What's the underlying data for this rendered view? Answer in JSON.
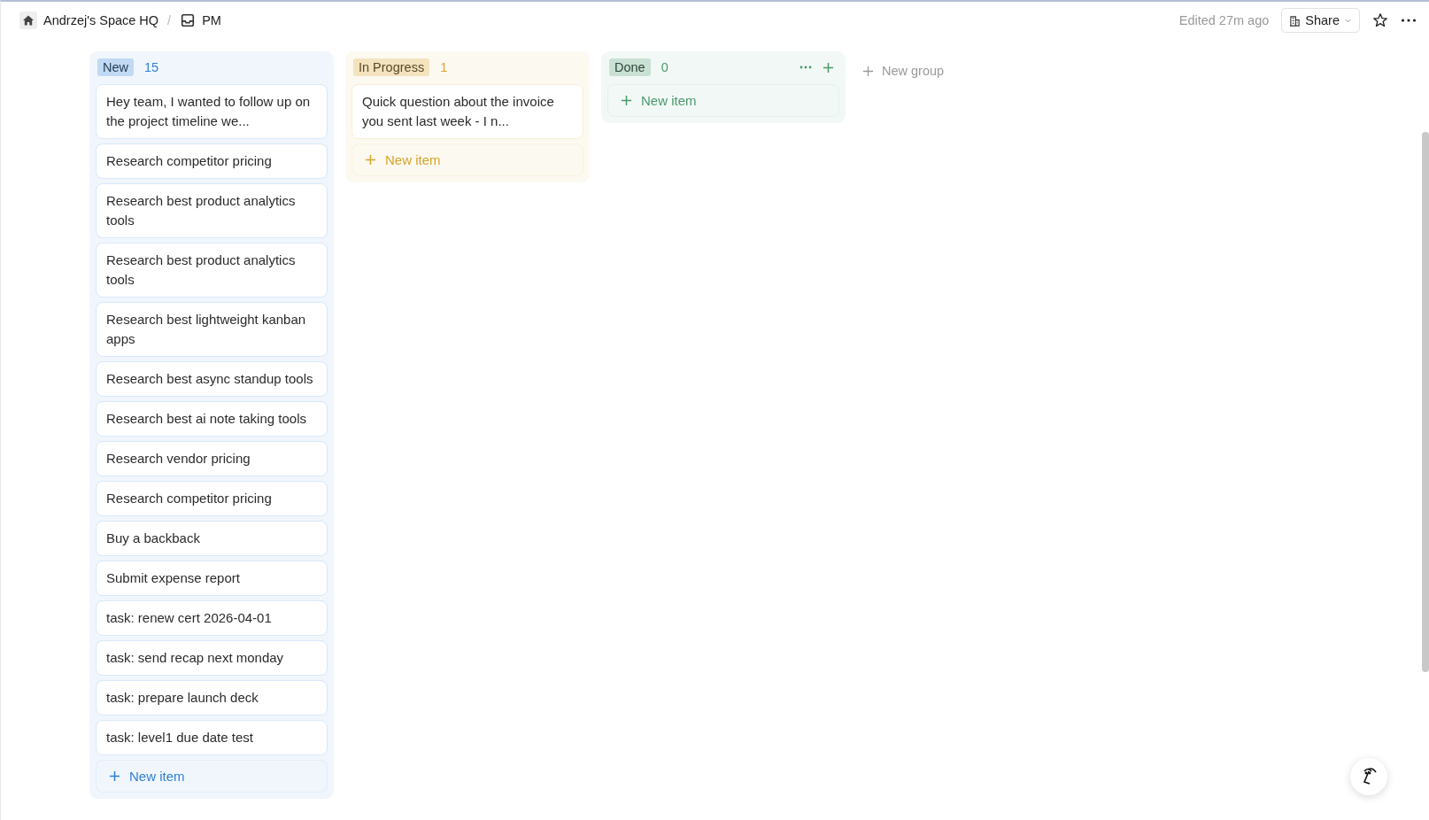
{
  "breadcrumb": [
    {
      "label": "Andrzej's Space HQ"
    },
    {
      "separator": "/",
      "label": "PM"
    }
  ],
  "header": {
    "edited": "Edited 27m ago",
    "share": "Share"
  },
  "groups": [
    {
      "name": "New",
      "count": "15",
      "color": "#2f80d6",
      "header_actions": false,
      "new_item": "New item",
      "cards": [
        "Hey team, I wanted to follow up on the project timeline we...",
        "Research competitor pricing",
        "Research best product analytics tools",
        "Research best product analytics tools",
        "Research best lightweight kanban apps",
        "Research best async standup tools",
        "Research best ai note taking tools",
        "Research vendor pricing",
        "Research competitor pricing",
        "Buy a backback",
        "Submit expense report",
        "task: renew cert 2026-04-01",
        "task: send recap next monday",
        "task: prepare launch deck",
        "task: level1 due date test"
      ]
    },
    {
      "name": "In Progress",
      "count": "1",
      "color": "#d9a32b",
      "header_actions": false,
      "new_item": "New item",
      "cards": [
        "Quick question about the invoice you sent last week - I n..."
      ]
    },
    {
      "name": "Done",
      "count": "0",
      "color": "#4b9a6e",
      "header_actions": true,
      "new_item": "New item"
    }
  ],
  "new_group": "New group"
}
